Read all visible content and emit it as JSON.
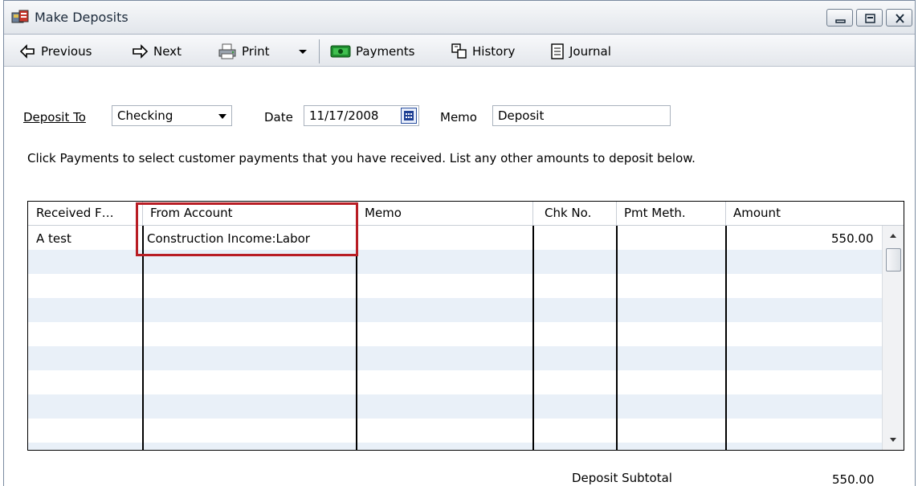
{
  "window": {
    "title": "Make Deposits",
    "controls": {
      "minimize": "minimize-icon",
      "maximize": "maximize-icon",
      "close": "close-icon"
    }
  },
  "toolbar": {
    "previous_label": "Previous",
    "next_label": "Next",
    "print_label": "Print",
    "payments_label": "Payments",
    "history_label": "History",
    "journal_label": "Journal"
  },
  "form": {
    "deposit_to_label": "Deposit To",
    "deposit_to_value": "Checking",
    "date_label": "Date",
    "date_value": "11/17/2008",
    "memo_label": "Memo",
    "memo_value": "Deposit"
  },
  "instruction": "Click Payments to select customer payments that you have received. List any other amounts to deposit below.",
  "table": {
    "columns": [
      "Received F…",
      "From Account",
      "Memo",
      "Chk No.",
      "Pmt Meth.",
      "Amount"
    ],
    "rows": [
      {
        "received_from": "A test",
        "from_account": "Construction Income:Labor",
        "memo": "",
        "chk_no": "",
        "pmt_meth": "",
        "amount": "550.00"
      }
    ]
  },
  "footer": {
    "subtotal_label": "Deposit Subtotal",
    "subtotal_value": "550.00"
  },
  "colors": {
    "highlight_border": "#b81d24",
    "row_stripe": "#e9f0f8"
  }
}
